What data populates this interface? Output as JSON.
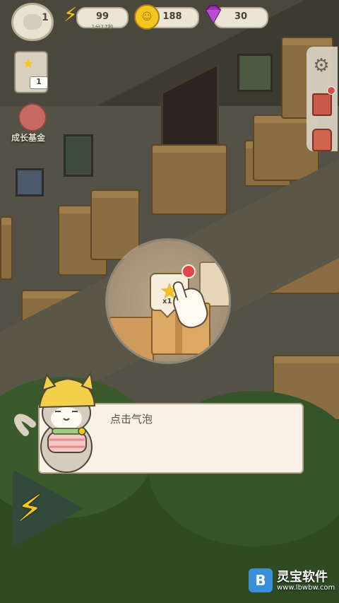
{
  "hud": {
    "player_level": "1",
    "energy": {
      "value": "99",
      "timer": "1分17秒",
      "icon": "lightning-icon",
      "color": "#f2c51f"
    },
    "coins": {
      "value": "188",
      "icon": "coin-icon",
      "color": "#f2c51f"
    },
    "gems": {
      "value": "30",
      "icon": "diamond-icon",
      "color": "#9b2fb5"
    }
  },
  "left_menu": {
    "task_badge": "1",
    "growth_fund_label": "成长基金"
  },
  "right_menu": {
    "items": [
      {
        "icon": "gear-icon"
      },
      {
        "icon": "book-icon",
        "has_notification": true
      },
      {
        "icon": "bag-icon"
      }
    ]
  },
  "tutorial": {
    "bubble_count": "x1",
    "bubble_icon": "star-icon",
    "dialog_text": "点击气泡"
  },
  "watermark": {
    "name": "灵宝软件",
    "url": "www.lbwbw.com"
  }
}
